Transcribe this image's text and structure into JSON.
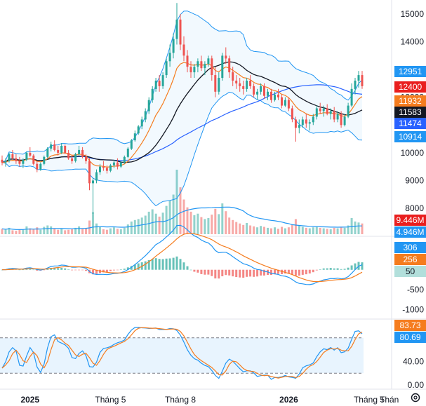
{
  "colors": {
    "up": "#26a69a",
    "down": "#ef5350",
    "bb": "#2196f3",
    "ma_fast": "#f57c1e",
    "ma_slow": "#131722",
    "ma_long": "#2962ff",
    "macd": "#2196f3",
    "signal": "#f57c1e",
    "stoch_k": "#2196f3",
    "stoch_d": "#f57c1e"
  },
  "price_axis": {
    "ticks": [
      "15000",
      "14000",
      "13000",
      "12000",
      "11000",
      "10000",
      "9000",
      "8000"
    ],
    "badges": [
      {
        "label": "12951",
        "value": 12951,
        "color": "#2196f3",
        "text": "light"
      },
      {
        "label": "12400",
        "value": 12400,
        "color": "#e91e1e",
        "text": "light"
      },
      {
        "label": "11932",
        "value": 11932,
        "color": "#f57c1e",
        "text": "light"
      },
      {
        "label": "11583",
        "value": 11583,
        "color": "#131722",
        "text": "light"
      },
      {
        "label": "11474",
        "value": 11474,
        "color": "#2962ff",
        "text": "light"
      },
      {
        "label": "10914",
        "value": 10914,
        "color": "#2196f3",
        "text": "light"
      }
    ]
  },
  "volume_axis": {
    "badges": [
      {
        "label": "9.446M",
        "color": "#e91e1e"
      },
      {
        "label": "4.946M",
        "color": "#2196f3"
      }
    ]
  },
  "macd_axis": {
    "ticks": [
      "-500",
      "-1000"
    ],
    "badges": [
      {
        "label": "306",
        "value": 306,
        "color": "#2196f3",
        "text": "light"
      },
      {
        "label": "256",
        "value": 256,
        "color": "#f57c1e",
        "text": "light"
      },
      {
        "label": "50",
        "value": 50,
        "color": "#b2dfdb",
        "text": "dark"
      }
    ]
  },
  "stoch_axis": {
    "ticks": [
      "40.00",
      "0.00"
    ],
    "badges": [
      {
        "label": "83.73",
        "value": 83.73,
        "color": "#f57c1e",
        "text": "light"
      },
      {
        "label": "80.69",
        "value": 80.69,
        "color": "#2196f3",
        "text": "light"
      }
    ],
    "upper_band": 80,
    "lower_band": 20
  },
  "time_axis": {
    "labels": [
      {
        "text": "2025",
        "bold": true,
        "index": 8
      },
      {
        "text": "Tháng 5",
        "bold": false,
        "index": 31
      },
      {
        "text": "Tháng 8",
        "bold": false,
        "index": 51
      },
      {
        "text": "2026",
        "bold": true,
        "index": 82
      },
      {
        "text": "Tháng 5",
        "bold": false,
        "index": 105
      },
      {
        "text": "Thán",
        "bold": false,
        "index": 123
      }
    ]
  },
  "settings_icon": "gear-icon",
  "chart_data": {
    "type": "candlestick",
    "title": "",
    "ylim": [
      7600,
      15500
    ],
    "candles": [
      [
        9750,
        9900,
        9550,
        9650
      ],
      [
        9650,
        9800,
        9500,
        9700
      ],
      [
        9700,
        10000,
        9650,
        9950
      ],
      [
        9950,
        10100,
        9750,
        9800
      ],
      [
        9800,
        9950,
        9600,
        9700
      ],
      [
        9700,
        9850,
        9500,
        9600
      ],
      [
        9600,
        9800,
        9450,
        9750
      ],
      [
        9750,
        10050,
        9700,
        10000
      ],
      [
        10000,
        10200,
        9850,
        9900
      ],
      [
        9900,
        9950,
        9550,
        9600
      ],
      [
        9600,
        9700,
        9300,
        9400
      ],
      [
        9400,
        9650,
        9350,
        9600
      ],
      [
        9600,
        9900,
        9550,
        9850
      ],
      [
        9850,
        10200,
        9800,
        10150
      ],
      [
        10150,
        10400,
        10050,
        10300
      ],
      [
        10300,
        10450,
        10050,
        10100
      ],
      [
        10100,
        10250,
        9900,
        10000
      ],
      [
        10000,
        10350,
        9950,
        10250
      ],
      [
        10250,
        10300,
        9950,
        10000
      ],
      [
        10000,
        10100,
        9750,
        9800
      ],
      [
        9800,
        9900,
        9600,
        9700
      ],
      [
        9700,
        10000,
        9650,
        9950
      ],
      [
        9950,
        10250,
        9900,
        10100
      ],
      [
        10100,
        10200,
        9800,
        9850
      ],
      [
        9850,
        9950,
        9600,
        9700
      ],
      [
        9700,
        9800,
        8650,
        8900
      ],
      [
        8900,
        9100,
        7800,
        9000
      ],
      [
        9000,
        9400,
        8900,
        9300
      ],
      [
        9300,
        9600,
        9200,
        9500
      ],
      [
        9500,
        9700,
        9350,
        9450
      ],
      [
        9450,
        9550,
        9250,
        9350
      ],
      [
        9350,
        9600,
        9300,
        9550
      ],
      [
        9550,
        9750,
        9450,
        9650
      ],
      [
        9650,
        9800,
        9400,
        9500
      ],
      [
        9500,
        9700,
        9450,
        9650
      ],
      [
        9650,
        9900,
        9600,
        9850
      ],
      [
        9850,
        10200,
        9800,
        10150
      ],
      [
        10150,
        10500,
        10100,
        10450
      ],
      [
        10450,
        10800,
        10400,
        10700
      ],
      [
        10700,
        11000,
        10650,
        10950
      ],
      [
        10950,
        11300,
        10850,
        11200
      ],
      [
        11200,
        11600,
        11100,
        11500
      ],
      [
        11500,
        12000,
        11400,
        11900
      ],
      [
        11900,
        12400,
        11800,
        12300
      ],
      [
        12300,
        12700,
        12200,
        12600
      ],
      [
        12600,
        12800,
        12200,
        12400
      ],
      [
        12400,
        12900,
        12300,
        12800
      ],
      [
        12800,
        13400,
        12700,
        13300
      ],
      [
        13300,
        13900,
        13100,
        13600
      ],
      [
        13600,
        14300,
        13400,
        14100
      ],
      [
        14100,
        15400,
        13900,
        14800
      ],
      [
        14800,
        15000,
        13700,
        13900
      ],
      [
        13900,
        14200,
        13300,
        13500
      ],
      [
        13500,
        13700,
        12900,
        13100
      ],
      [
        13100,
        13300,
        12700,
        12900
      ],
      [
        12900,
        13200,
        12700,
        13100
      ],
      [
        13100,
        13400,
        12900,
        13300
      ],
      [
        13300,
        13500,
        12950,
        13050
      ],
      [
        13050,
        13300,
        12800,
        13200
      ],
      [
        13200,
        13500,
        13100,
        13400
      ],
      [
        13400,
        13500,
        12600,
        12800
      ],
      [
        12800,
        13100,
        12000,
        12200
      ],
      [
        12200,
        12900,
        12100,
        12700
      ],
      [
        12700,
        13600,
        12600,
        13500
      ],
      [
        13500,
        13800,
        13200,
        13400
      ],
      [
        13400,
        13500,
        12700,
        12900
      ],
      [
        12900,
        13100,
        12400,
        12600
      ],
      [
        12600,
        12800,
        12300,
        12500
      ],
      [
        12500,
        12700,
        12200,
        12400
      ],
      [
        12400,
        12600,
        12100,
        12300
      ],
      [
        12300,
        12700,
        12200,
        12600
      ],
      [
        12600,
        12800,
        12300,
        12400
      ],
      [
        12400,
        12500,
        12000,
        12100
      ],
      [
        12100,
        12300,
        11900,
        12200
      ],
      [
        12200,
        12500,
        12100,
        12400
      ],
      [
        12400,
        12500,
        11950,
        12050
      ],
      [
        12050,
        12300,
        11900,
        12200
      ],
      [
        12200,
        12300,
        11800,
        11900
      ],
      [
        11900,
        12200,
        11850,
        12100
      ],
      [
        12100,
        12300,
        11900,
        12000
      ],
      [
        12000,
        12100,
        11600,
        11700
      ],
      [
        11700,
        12000,
        11650,
        11900
      ],
      [
        11900,
        12000,
        11500,
        11600
      ],
      [
        11600,
        11700,
        11100,
        11200
      ],
      [
        11200,
        11300,
        10400,
        10900
      ],
      [
        10900,
        11200,
        10700,
        11000
      ],
      [
        11000,
        11300,
        10900,
        11200
      ],
      [
        11200,
        11400,
        10900,
        11050
      ],
      [
        11050,
        11200,
        10800,
        11100
      ],
      [
        11100,
        11400,
        11000,
        11300
      ],
      [
        11300,
        11700,
        11200,
        11600
      ],
      [
        11600,
        11800,
        11400,
        11500
      ],
      [
        11500,
        11700,
        11300,
        11600
      ],
      [
        11600,
        11750,
        11350,
        11400
      ],
      [
        11400,
        11600,
        11200,
        11500
      ],
      [
        11500,
        11650,
        11100,
        11200
      ],
      [
        11200,
        11500,
        11100,
        11400
      ],
      [
        11400,
        11500,
        10900,
        11000
      ],
      [
        11000,
        11400,
        10950,
        11300
      ],
      [
        11300,
        11800,
        11250,
        11700
      ],
      [
        11700,
        12500,
        11650,
        12300
      ],
      [
        12300,
        12700,
        12100,
        12600
      ],
      [
        12600,
        12950,
        12350,
        12800
      ],
      [
        12800,
        12950,
        12300,
        12400
      ]
    ],
    "volume": [
      1.1,
      0.9,
      1.3,
      0.8,
      0.7,
      1.0,
      0.9,
      1.6,
      1.2,
      1.0,
      1.4,
      0.9,
      1.5,
      1.8,
      1.6,
      1.2,
      0.9,
      1.1,
      0.8,
      0.9,
      1.0,
      1.3,
      1.6,
      1.1,
      1.2,
      2.8,
      4.5,
      2.2,
      1.5,
      1.0,
      0.9,
      1.2,
      1.4,
      1.1,
      1.0,
      1.3,
      2.0,
      2.6,
      2.9,
      3.1,
      3.4,
      3.8,
      4.6,
      5.1,
      4.2,
      3.6,
      4.4,
      5.8,
      6.9,
      8.1,
      13.2,
      9.6,
      7.1,
      5.5,
      4.6,
      3.9,
      4.2,
      3.5,
      3.1,
      3.3,
      4.0,
      5.2,
      4.1,
      6.3,
      4.7,
      3.4,
      2.9,
      2.5,
      2.2,
      1.9,
      2.3,
      1.8,
      1.6,
      1.4,
      1.7,
      1.5,
      1.3,
      1.2,
      1.4,
      1.1,
      1.5,
      1.2,
      1.4,
      2.0,
      3.1,
      1.8,
      1.5,
      1.3,
      1.2,
      1.4,
      1.6,
      1.3,
      1.2,
      1.1,
      1.0,
      1.3,
      1.2,
      1.4,
      1.3,
      1.8,
      3.3,
      2.6,
      2.4,
      2.2
    ],
    "macd_ylim": [
      -1150,
      700
    ],
    "stoch_ylim": [
      0,
      100
    ]
  }
}
